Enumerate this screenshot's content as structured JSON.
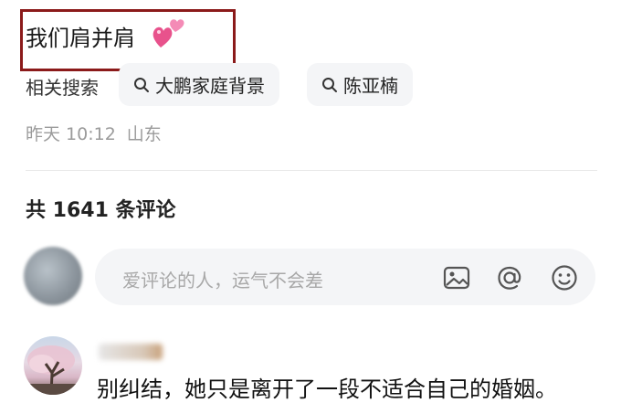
{
  "post": {
    "title": "我们肩并肩",
    "title_emoji": "two-hearts-emoji"
  },
  "related_search": {
    "label": "相关搜索",
    "chips": [
      {
        "label": "大鹏家庭背景",
        "icon": "search-icon"
      },
      {
        "label": "陈亚楠",
        "icon": "search-icon"
      }
    ]
  },
  "meta": {
    "time": "昨天 10:12",
    "location": "山东"
  },
  "comments": {
    "count_text": "共 1641 条评论",
    "input_placeholder": "爱评论的人，运气不会差",
    "input_icons": [
      "image-icon",
      "at-icon",
      "emoji-icon"
    ],
    "first_comment_text": "别纠结，她只是离开了一段不适合自己的婚姻。"
  },
  "colors": {
    "highlight_box": "#8b1a1a",
    "chip_bg": "#f4f5f7",
    "meta_text": "#9b9b9b",
    "heart_pink": "#f06292"
  }
}
